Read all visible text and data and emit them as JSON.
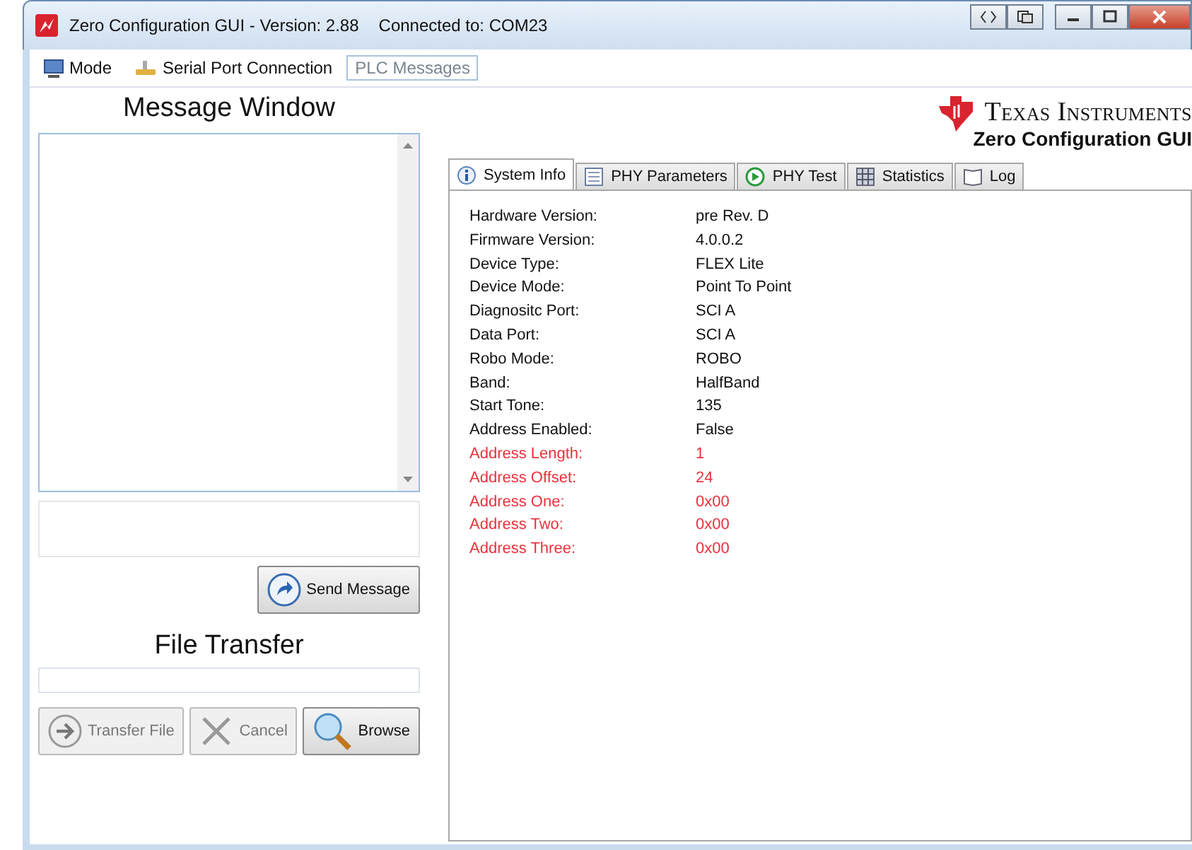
{
  "window": {
    "title": "Zero Configuration GUI - Version: 2.88",
    "connection": "Connected to: COM23"
  },
  "menu": [
    {
      "label": "Mode",
      "selected": false
    },
    {
      "label": "Serial Port Connection",
      "selected": false
    },
    {
      "label": "PLC Messages",
      "selected": true
    }
  ],
  "message_window": {
    "title": "Message Window",
    "send_button": "Send Message"
  },
  "file_transfer": {
    "title": "File Transfer",
    "buttons": [
      {
        "label": "Transfer File",
        "kind": "transfer",
        "disabled": true
      },
      {
        "label": "Cancel",
        "kind": "cancel",
        "disabled": true
      },
      {
        "label": "Browse",
        "kind": "browse",
        "disabled": false
      }
    ]
  },
  "logo": {
    "company": "Texas Instruments",
    "product": "Zero Configuration GUI"
  },
  "tabs": [
    {
      "label": "System Info",
      "selected": true
    },
    {
      "label": "PHY Parameters",
      "selected": false
    },
    {
      "label": "PHY Test",
      "selected": false
    },
    {
      "label": "Statistics",
      "selected": false
    },
    {
      "label": "Log",
      "selected": false
    }
  ],
  "system_info": [
    {
      "label": "Hardware Version:",
      "value": "pre Rev. D",
      "highlighted": false
    },
    {
      "label": "Firmware Version:",
      "value": "4.0.0.2",
      "highlighted": false
    },
    {
      "label": "Device Type:",
      "value": "FLEX Lite",
      "highlighted": false
    },
    {
      "label": "Device Mode:",
      "value": "Point To Point",
      "highlighted": false
    },
    {
      "label": "Diagnositc Port:",
      "value": "SCI A",
      "highlighted": false
    },
    {
      "label": "Data Port:",
      "value": "SCI A",
      "highlighted": false
    },
    {
      "label": "Robo Mode:",
      "value": "ROBO",
      "highlighted": false
    },
    {
      "label": "Band:",
      "value": "HalfBand",
      "highlighted": false
    },
    {
      "label": "Start Tone:",
      "value": "135",
      "highlighted": false
    },
    {
      "label": "Address Enabled:",
      "value": "False",
      "highlighted": false
    },
    {
      "label": "Address Length:",
      "value": "1",
      "highlighted": true
    },
    {
      "label": "Address Offset:",
      "value": "24",
      "highlighted": true
    },
    {
      "label": "Address One:",
      "value": "0x00",
      "highlighted": true
    },
    {
      "label": "Address Two:",
      "value": "0x00",
      "highlighted": true
    },
    {
      "label": "Address Three:",
      "value": "0x00",
      "highlighted": true
    }
  ]
}
